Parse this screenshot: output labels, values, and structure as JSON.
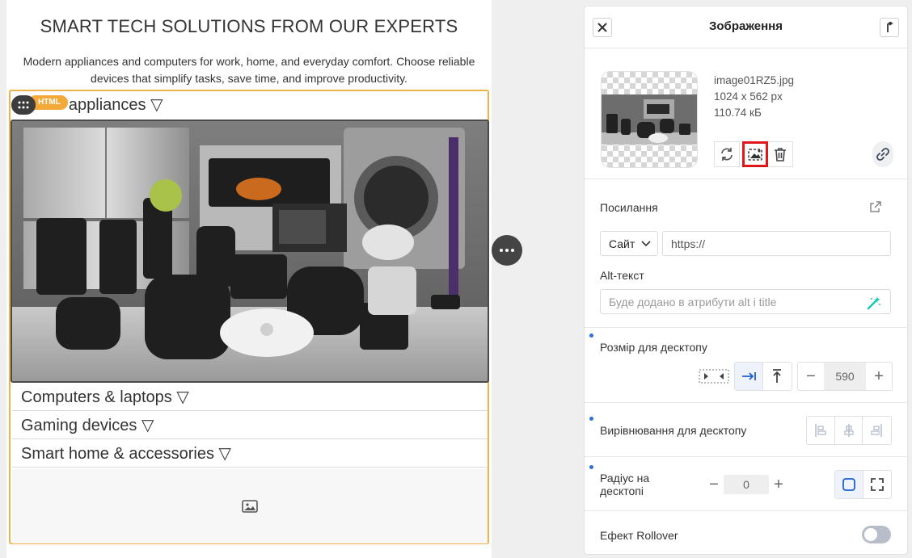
{
  "canvas": {
    "headline": "SMART TECH SOLUTIONS FROM OUR EXPERTS",
    "subtitle": "Modern appliances and computers for work, home, and everyday comfort. Choose reliable devices that simplify tasks, save time, and improve productivity.",
    "badge": "HTML",
    "accordion": [
      {
        "label": "Home appliances ▽"
      },
      {
        "label": "Computers & laptops ▽"
      },
      {
        "label": "Gaming devices ▽"
      },
      {
        "label": "Smart home & accessories ▽"
      }
    ],
    "image_icon": "image-placeholder-icon"
  },
  "panel": {
    "title": "Зображення",
    "image": {
      "filename": "image01RZ5.jpg",
      "dimensions": "1024 x 562 px",
      "size": "110.74 кБ"
    },
    "link": {
      "label": "Посилання",
      "protocol": "Сайт",
      "url_placeholder": "https://"
    },
    "alt": {
      "label": "Alt-текст",
      "placeholder": "Буде додано в атрибути alt і title"
    },
    "size": {
      "label": "Розмір для десктопу",
      "value": "590"
    },
    "align": {
      "label": "Вирівнювання для десктопу"
    },
    "radius": {
      "label": "Радіус на десктопі",
      "value": "0"
    },
    "rollover": {
      "label": "Ефект Rollover",
      "enabled": false
    },
    "colors": {
      "accent": "#f2b04b",
      "highlight": "#e0161b",
      "brand_blue": "#2f6fd9"
    }
  }
}
